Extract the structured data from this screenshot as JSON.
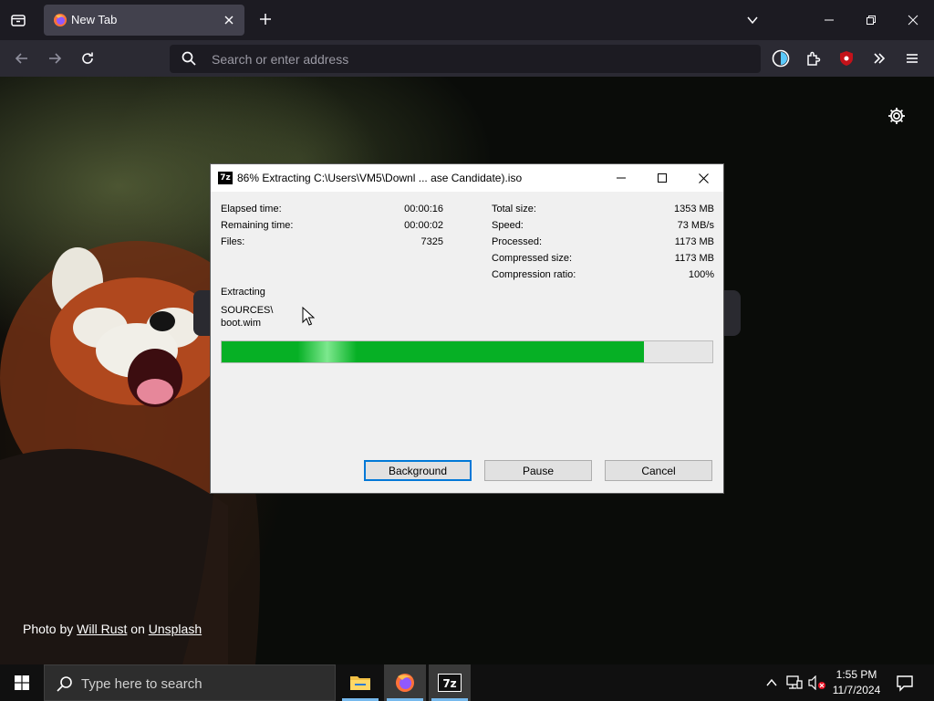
{
  "browser": {
    "tab": {
      "title": "New Tab"
    },
    "urlbar": {
      "placeholder": "Search or enter address"
    }
  },
  "newtab_page": {
    "credit": {
      "prefix": "Photo by",
      "author": "Will Rust",
      "middle": "on",
      "site": "Unsplash"
    }
  },
  "dialog": {
    "title": "86% Extracting C:\\Users\\VM5\\Downl ... ase Candidate).iso",
    "stats_left": [
      {
        "label": "Elapsed time:",
        "value": "00:00:16"
      },
      {
        "label": "Remaining time:",
        "value": "00:00:02"
      },
      {
        "label": "Files:",
        "value": "7325"
      }
    ],
    "stats_right": [
      {
        "label": "Total size:",
        "value": "1353 MB"
      },
      {
        "label": "Speed:",
        "value": "73 MB/s"
      },
      {
        "label": "Processed:",
        "value": "1173 MB"
      },
      {
        "label": "Compressed size:",
        "value": "1173 MB"
      },
      {
        "label": "Compression ratio:",
        "value": "100%"
      }
    ],
    "operation": "Extracting",
    "current_path": "SOURCES\\",
    "current_file": "boot.wim",
    "progress": 0.86,
    "buttons": {
      "background": "Background",
      "pause": "Pause",
      "cancel": "Cancel"
    },
    "icon_text": "7z"
  },
  "taskbar": {
    "search_placeholder": "Type here to search",
    "time": "1:55 PM",
    "date": "11/7/2024",
    "apps": [
      "file-explorer-icon",
      "firefox-icon",
      "7zip-icon"
    ]
  },
  "colors": {
    "progress_fill": "#06b025",
    "default_button_border": "#0078d7",
    "taskbar_underline": "#76b9ed"
  }
}
